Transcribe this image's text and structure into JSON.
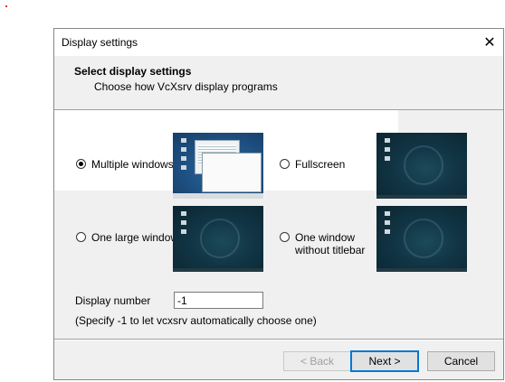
{
  "dialog": {
    "title": "Display settings",
    "close_glyph": "✕"
  },
  "header": {
    "title": "Select display settings",
    "subtitle": "Choose how VcXsrv display programs"
  },
  "options": [
    {
      "label": "Multiple windows",
      "checked": true
    },
    {
      "label": "Fullscreen",
      "checked": false
    },
    {
      "label": "One large window",
      "checked": false
    },
    {
      "label_line1": "One window",
      "label_line2": "without titlebar",
      "checked": false
    }
  ],
  "display_number": {
    "label": "Display number",
    "value": "-1",
    "hint": "(Specify -1 to let vcxsrv automatically choose one)"
  },
  "buttons": {
    "back": "< Back",
    "next": "Next >",
    "cancel": "Cancel"
  },
  "icons": [
    "close-icon",
    "radio-icon",
    "preview-thumbnail"
  ]
}
